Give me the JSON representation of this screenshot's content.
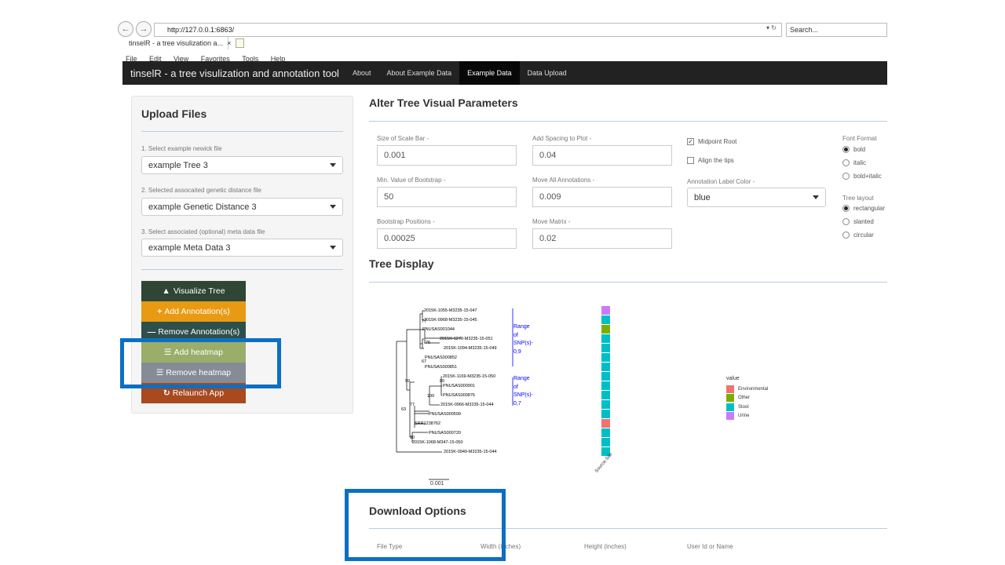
{
  "browser": {
    "url": "http://127.0.0.1:6863/",
    "search_placeholder": "Search...",
    "tab_title": "tinselR - a tree visulization a...",
    "menu": [
      "File",
      "Edit",
      "View",
      "Favorites",
      "Tools",
      "Help"
    ]
  },
  "navbar": {
    "brand": "tinselR - a tree visulization and annotation tool",
    "links": [
      "About",
      "About Example Data",
      "Example Data",
      "Data Upload"
    ],
    "active": "Example Data"
  },
  "sidebar": {
    "title": "Upload Files",
    "newick_label": "1. Select example newick file",
    "newick_value": "example Tree 3",
    "distance_label": "2. Selected assocaited genetic distance file",
    "distance_value": "example Genetic Distance 3",
    "meta_label": "3. Select associated (optional) meta data file",
    "meta_value": "example Meta Data 3",
    "buttons": {
      "visualize": "Visualize Tree",
      "add_annotation": "Add Annotation(s)",
      "remove_annotation": "Remove Annotation(s)",
      "add_heatmap": "Add heatmap",
      "remove_heatmap": "Remove heatmap",
      "relaunch": "Relaunch App"
    },
    "colors": {
      "visualize": "#2f4535",
      "add_annotation": "#e89a12",
      "remove_annotation": "#2f4f4a",
      "add_heatmap": "#9aae6a",
      "remove_heatmap": "#858c96",
      "relaunch": "#a9491e"
    }
  },
  "params": {
    "title": "Alter Tree Visual Parameters",
    "scale_bar_label": "Size of Scale Bar -",
    "scale_bar_value": "0.001",
    "spacing_label": "Add Spacing to Plot -",
    "spacing_value": "0.04",
    "bootstrap_min_label": "Min. Value of Bootstrap -",
    "bootstrap_min_value": "50",
    "move_annotations_label": "Move All Annotations -",
    "move_annotations_value": "0.009",
    "bootstrap_pos_label": "Bootstrap Positions -",
    "bootstrap_pos_value": "0.00025",
    "move_matrix_label": "Move Matrix -",
    "move_matrix_value": "0.02",
    "midpoint_root": "Midpoint Root",
    "align_tips": "Align the tips",
    "annotation_color_label": "Annotation Label Color -",
    "annotation_color_value": "blue",
    "font_format_label": "Font Format",
    "font_options": [
      "bold",
      "italic",
      "bold+italic"
    ],
    "tree_layout_label": "Tree layout",
    "layout_options": [
      "rectangular",
      "slanted",
      "circular"
    ]
  },
  "tree": {
    "title": "Tree Display",
    "tips": [
      "2015K-1055-M3235-15-047",
      "2015K-0968-M3235-15-045",
      "PNUSAS001044",
      "2015K-1270-M3235-15-051",
      "2015K-1094-M3235-15-049",
      "PNUSAS000852",
      "PNUSAS000851",
      "2015K-1169-M3235-15-050",
      "PNUSAS000901",
      "PNUSAS000876",
      "2015K-0966-M3235-15-044",
      "PNUSAS000599",
      "SRR1238762",
      "PNUSAS000720",
      "2015K-1068-M347-15-050",
      "2015K-0949-M3235-15-044"
    ],
    "bootstraps": [
      "77",
      "76",
      "67",
      "99",
      "80",
      "100",
      "77",
      "63",
      "90"
    ],
    "annotation1": [
      "Range",
      "of",
      "SNP(s)-",
      "0,9"
    ],
    "annotation2": [
      "Range",
      "of",
      "SNP(s)-",
      "0,7"
    ],
    "scale": "0.001",
    "heatmap_axis": "Source.Site",
    "legend_title": "value",
    "legend": [
      {
        "label": "Environmental",
        "color": "#f0746e"
      },
      {
        "label": "Other",
        "color": "#7cae00"
      },
      {
        "label": "Stool",
        "color": "#00bfc4"
      },
      {
        "label": "Urine",
        "color": "#c77cff"
      }
    ],
    "heatmap_cells": [
      "Urine",
      "Stool",
      "Other",
      "Stool",
      "Stool",
      "Stool",
      "Stool",
      "Stool",
      "Stool",
      "Stool",
      "Stool",
      "Stool",
      "Environmental",
      "Stool",
      "Stool",
      "Stool"
    ]
  },
  "download": {
    "title": "Download Options",
    "columns": [
      "File Type",
      "Width (inches)",
      "Height (inches)",
      "User Id or Name"
    ]
  },
  "highlight_color": "#0b6fc4"
}
